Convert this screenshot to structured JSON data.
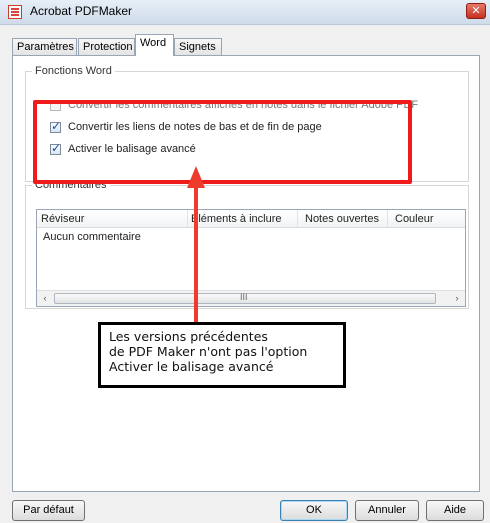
{
  "window": {
    "title": "Acrobat PDFMaker",
    "close_glyph": "✕"
  },
  "tabs": [
    {
      "label": "Paramètres",
      "active": false
    },
    {
      "label": "Protection",
      "active": false
    },
    {
      "label": "Word",
      "active": true
    },
    {
      "label": "Signets",
      "active": false
    }
  ],
  "word_functions": {
    "legend": "Fonctions Word",
    "options": [
      {
        "label": "Convertir les commentaires affichés en notes dans le fichier Adobe PDF",
        "checked": false,
        "enabled": false
      },
      {
        "label": "Convertir les liens de notes de bas et de fin de page",
        "checked": true,
        "enabled": true
      },
      {
        "label": "Activer le balisage avancé",
        "checked": true,
        "enabled": true
      }
    ]
  },
  "comments": {
    "legend": "Commentaires",
    "columns": [
      "Réviseur",
      "Eléments à inclure",
      "Notes ouvertes",
      "Couleur"
    ],
    "empty_text": "Aucun commentaire",
    "scroll_left": "‹",
    "scroll_right": "›",
    "scroll_grip": "III"
  },
  "annotation": {
    "line1": "Les versions précédentes",
    "line2": "de PDF Maker n'ont pas l'option",
    "line3": "Activer le balisage avancé",
    "highlight_color": "#ef1b1b"
  },
  "buttons": {
    "defaults": "Par défaut",
    "ok": "OK",
    "cancel": "Annuler",
    "help": "Aide"
  }
}
